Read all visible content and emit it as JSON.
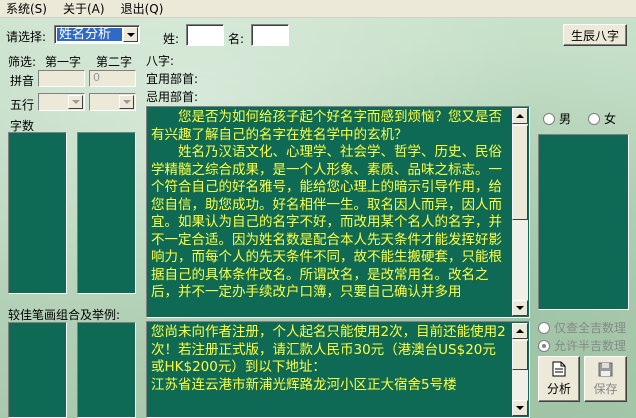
{
  "menu": [
    "系统(S)",
    "关于(A)",
    "退出(Q)"
  ],
  "top": {
    "select_label": "请选择:",
    "select_value": "姓名分析",
    "surname_label": "姓:",
    "name_label": "名:",
    "surname_value": "",
    "name_value": "",
    "bazi_button": "生辰八字"
  },
  "filter": {
    "label": "筛选:",
    "first_char": "第一字",
    "second_char": "第二字",
    "pinyin_label": "拼音",
    "pinyin_second": "0",
    "wuxing_label": "五行",
    "zishu_label": "字数"
  },
  "bazi": {
    "bazi_label": "八字:",
    "yi_label": "宜用部首:",
    "ji_label": "忌用部首:"
  },
  "combo_label": "较佳笔画组合及举例:",
  "intro": {
    "p1": "您是否为如何给孩子起个好名字而感到烦恼？您又是否有兴趣了解自己的名字在姓名学中的玄机？",
    "p2": "姓名乃汉语文化、心理学、社会学、哲学、历史、民俗学精髓之综合成果，是一个人形象、素质、品味之标志。一个符合自己的好名雅号，能给您心理上的暗示引导作用，给您自信，助您成功。好名相伴一生。取名因人而异，因人而宜。如果认为自己的名字不好，而改用某个名人的名字，并不一定合适。因为姓名数是配合本人先天条件才能发挥好影响力，而每个人的先天条件不同，故不能生搬硬套，只能根据自己的具体条件改名。所谓改名，是改常用名。改名之后，并不一定办手续改户口簿，只要自己确认并多用"
  },
  "register": {
    "text": "您尚未向作者注册，个人起名只能使用2次，目前还能使用2次！若注册正式版，请汇款人民币30元（港澳台US$20元或HK$200元）到以下地址：",
    "address": "江苏省连云港市新浦光辉路龙河小区正大宿舍5号楼"
  },
  "gender": {
    "male": "男",
    "female": "女"
  },
  "options": {
    "only_lucky": "仅查全吉数理",
    "allow_half": "允许半吉数理"
  },
  "actions": {
    "analyze": "分析",
    "save": "保存"
  },
  "colors": {
    "panel_bg": "#0e6a55",
    "panel_text": "#ffff40",
    "select_highlight": "#316ac5"
  }
}
